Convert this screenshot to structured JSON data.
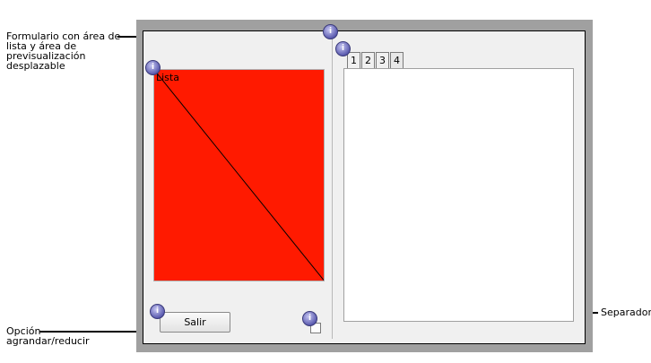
{
  "callouts": {
    "form": "Formulario con área de\nlista y área de\nprevisualización\ndesplazable",
    "resize": "Opción\nagrandar/reducir",
    "separator": "Separador"
  },
  "window": {
    "list_area_text": "Lista",
    "list_area_color": "#ff1a00",
    "tabs": [
      "1",
      "2",
      "3",
      "4"
    ],
    "active_tab": "4",
    "exit_button": "Salir"
  },
  "badge_glyph": "i"
}
